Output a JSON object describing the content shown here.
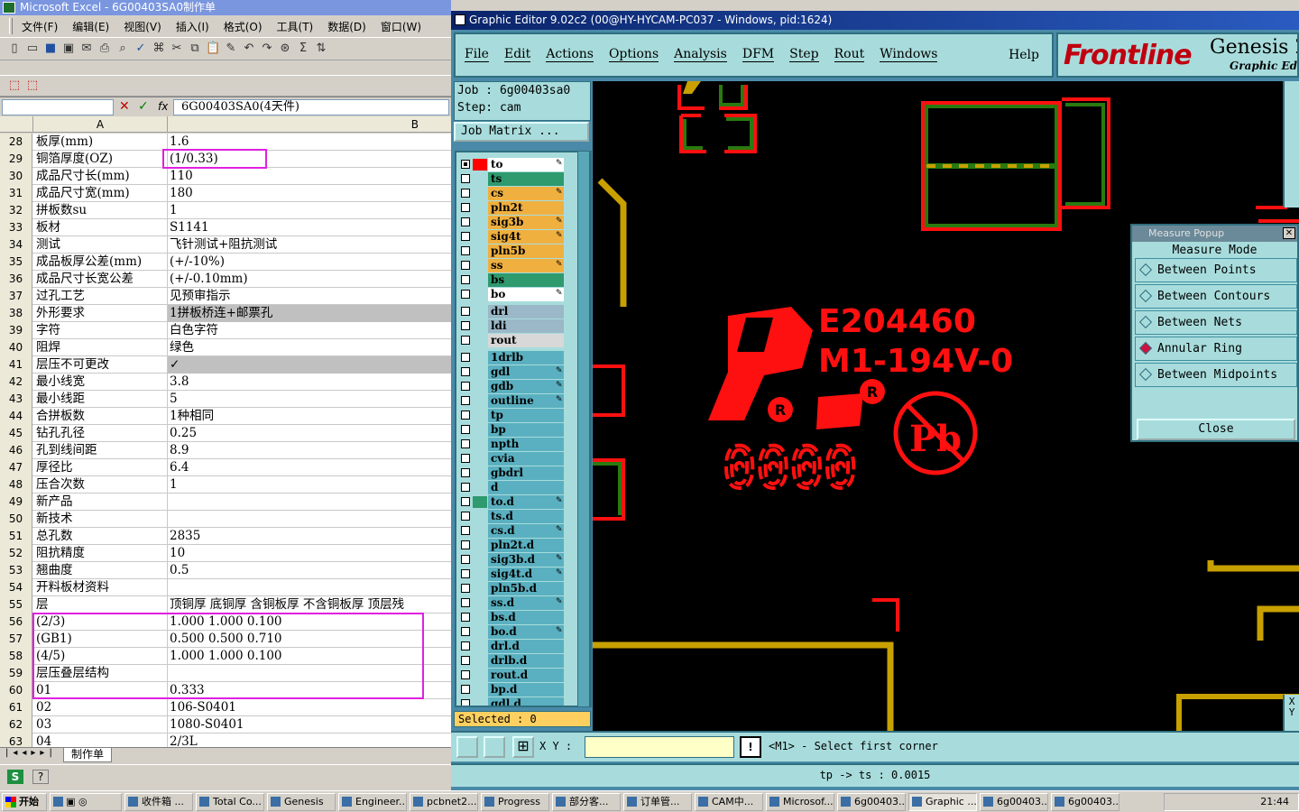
{
  "excel": {
    "title": "Microsoft Excel - 6G00403SA0制作单",
    "menu": [
      "文件(F)",
      "编辑(E)",
      "视图(V)",
      "插入(I)",
      "格式(O)",
      "工具(T)",
      "数据(D)",
      "窗口(W)"
    ],
    "formula_value": "6G00403SA0(4天件)",
    "columns": [
      "A",
      "B"
    ],
    "rows": [
      {
        "n": "28",
        "a": "板厚(mm)",
        "b": "1.6"
      },
      {
        "n": "29",
        "a": "铜箔厚度(OZ)",
        "b": "(1/0.33)"
      },
      {
        "n": "30",
        "a": "成品尺寸长(mm)",
        "b": "110"
      },
      {
        "n": "31",
        "a": "成品尺寸宽(mm)",
        "b": "180"
      },
      {
        "n": "32",
        "a": "拼板数su",
        "b": "1"
      },
      {
        "n": "33",
        "a": "板材",
        "b": "S1141"
      },
      {
        "n": "34",
        "a": "测试",
        "b": "飞针测试+阻抗测试"
      },
      {
        "n": "35",
        "a": "成品板厚公差(mm)",
        "b": "(+/-10%)"
      },
      {
        "n": "36",
        "a": "成品尺寸长宽公差",
        "b": "(+/-0.10mm)"
      },
      {
        "n": "37",
        "a": "过孔工艺",
        "b": "见预审指示"
      },
      {
        "n": "38",
        "a": "外形要求",
        "b": "1拼板桥连+邮票孔",
        "grey": true
      },
      {
        "n": "39",
        "a": "字符",
        "b": "白色字符"
      },
      {
        "n": "40",
        "a": "阻焊",
        "b": "绿色"
      },
      {
        "n": "41",
        "a": "层压不可更改",
        "b": "✓",
        "grey": true
      },
      {
        "n": "42",
        "a": "最小线宽",
        "b": "3.8"
      },
      {
        "n": "43",
        "a": "最小线距",
        "b": "5"
      },
      {
        "n": "44",
        "a": "合拼板数",
        "b": "1种相同"
      },
      {
        "n": "45",
        "a": "钻孔孔径",
        "b": "0.25"
      },
      {
        "n": "46",
        "a": "孔到线间距",
        "b": "8.9"
      },
      {
        "n": "47",
        "a": "厚径比",
        "b": "6.4"
      },
      {
        "n": "48",
        "a": "压合次数",
        "b": "1"
      },
      {
        "n": "49",
        "a": "新产品",
        "b": ""
      },
      {
        "n": "50",
        "a": "新技术",
        "b": ""
      },
      {
        "n": "51",
        "a": "总孔数",
        "b": "2835"
      },
      {
        "n": "52",
        "a": "阻抗精度",
        "b": "10"
      },
      {
        "n": "53",
        "a": "翘曲度",
        "b": "0.5"
      },
      {
        "n": "54",
        "a": "开料板材资料",
        "b": ""
      },
      {
        "n": "55",
        "a": "层",
        "b": "顶铜厚 底铜厚 含铜板厚 不含铜板厚 顶层残"
      },
      {
        "n": "56",
        "a": "(2/3)",
        "b": "1.000  1.000        0.100"
      },
      {
        "n": "57",
        "a": "(GB1)",
        "b": "0.500  0.500        0.710"
      },
      {
        "n": "58",
        "a": "(4/5)",
        "b": "1.000  1.000        0.100"
      },
      {
        "n": "59",
        "a": "层压叠层结构",
        "b": ""
      },
      {
        "n": "60",
        "a": "01",
        "b": "0.333"
      },
      {
        "n": "61",
        "a": "02",
        "b": "106-S0401"
      },
      {
        "n": "62",
        "a": "03",
        "b": "1080-S0401"
      },
      {
        "n": "63",
        "a": "04",
        "b": "2/3L"
      }
    ],
    "sheet_tab": "制作单"
  },
  "genesis": {
    "title": "Graphic Editor 9.02c2 (00@HY-HYCAM-PC037 - Windows, pid:1624)",
    "menu": [
      "File",
      "Edit",
      "Actions",
      "Options",
      "Analysis",
      "DFM",
      "Step",
      "Rout",
      "Windows"
    ],
    "help": "Help",
    "brand": "Frontline",
    "product": "Genesis 2",
    "product_sub": "Graphic Edit",
    "job_label": "Job : 6g00403sa0",
    "step_label": "Step: cam",
    "job_matrix": "Job Matrix ...",
    "layers": [
      {
        "name": "to",
        "color": "#ffffff",
        "ind": "#ff0000",
        "on": true,
        "w": true
      },
      {
        "name": "ts",
        "color": "#2e9a6e",
        "ind": "#a8dcdc",
        "on": false,
        "w": false
      },
      {
        "name": "cs",
        "color": "#f0b040",
        "ind": "#a8dcdc",
        "on": false,
        "w": true
      },
      {
        "name": "pln2t",
        "color": "#f0b040",
        "ind": "#a8dcdc",
        "on": false,
        "w": false
      },
      {
        "name": "sig3b",
        "color": "#f0b040",
        "ind": "#a8dcdc",
        "on": false,
        "w": true
      },
      {
        "name": "sig4t",
        "color": "#f0b040",
        "ind": "#a8dcdc",
        "on": false,
        "w": true
      },
      {
        "name": "pln5b",
        "color": "#f0b040",
        "ind": "#a8dcdc",
        "on": false,
        "w": false
      },
      {
        "name": "ss",
        "color": "#f0b040",
        "ind": "#a8dcdc",
        "on": false,
        "w": true
      },
      {
        "name": "bs",
        "color": "#2e9a6e",
        "ind": "#a8dcdc",
        "on": false,
        "w": false
      },
      {
        "name": "bo",
        "color": "#ffffff",
        "ind": "#a8dcdc",
        "on": false,
        "w": true
      },
      {
        "name": "drl",
        "color": "#9ab8c8",
        "ind": "#a8dcdc",
        "on": false,
        "w": false
      },
      {
        "name": "ldi",
        "color": "#9ab8c8",
        "ind": "#a8dcdc",
        "on": false,
        "w": false
      },
      {
        "name": "rout",
        "color": "#d8d8d8",
        "ind": "#a8dcdc",
        "on": false,
        "w": false
      },
      {
        "name": "1drlb",
        "color": "#5ab0c0",
        "ind": "#a8dcdc",
        "on": false,
        "w": false
      },
      {
        "name": "gdl",
        "color": "#5ab0c0",
        "ind": "#a8dcdc",
        "on": false,
        "w": true
      },
      {
        "name": "gdb",
        "color": "#5ab0c0",
        "ind": "#a8dcdc",
        "on": false,
        "w": true
      },
      {
        "name": "outline",
        "color": "#5ab0c0",
        "ind": "#a8dcdc",
        "on": false,
        "w": true
      },
      {
        "name": "tp",
        "color": "#5ab0c0",
        "ind": "#a8dcdc",
        "on": false,
        "w": false
      },
      {
        "name": "bp",
        "color": "#5ab0c0",
        "ind": "#a8dcdc",
        "on": false,
        "w": false
      },
      {
        "name": "npth",
        "color": "#5ab0c0",
        "ind": "#a8dcdc",
        "on": false,
        "w": false
      },
      {
        "name": "cvia",
        "color": "#5ab0c0",
        "ind": "#a8dcdc",
        "on": false,
        "w": false
      },
      {
        "name": "gbdrl",
        "color": "#5ab0c0",
        "ind": "#a8dcdc",
        "on": false,
        "w": false
      },
      {
        "name": "d",
        "color": "#5ab0c0",
        "ind": "#a8dcdc",
        "on": false,
        "w": false
      },
      {
        "name": "to.d",
        "color": "#5ab0c0",
        "ind": "#2e9a6e",
        "on": false,
        "w": true
      },
      {
        "name": "ts.d",
        "color": "#5ab0c0",
        "ind": "#a8dcdc",
        "on": false,
        "w": false
      },
      {
        "name": "cs.d",
        "color": "#5ab0c0",
        "ind": "#a8dcdc",
        "on": false,
        "w": true
      },
      {
        "name": "pln2t.d",
        "color": "#5ab0c0",
        "ind": "#a8dcdc",
        "on": false,
        "w": false
      },
      {
        "name": "sig3b.d",
        "color": "#5ab0c0",
        "ind": "#a8dcdc",
        "on": false,
        "w": true
      },
      {
        "name": "sig4t.d",
        "color": "#5ab0c0",
        "ind": "#a8dcdc",
        "on": false,
        "w": true
      },
      {
        "name": "pln5b.d",
        "color": "#5ab0c0",
        "ind": "#a8dcdc",
        "on": false,
        "w": false
      },
      {
        "name": "ss.d",
        "color": "#5ab0c0",
        "ind": "#a8dcdc",
        "on": false,
        "w": true
      },
      {
        "name": "bs.d",
        "color": "#5ab0c0",
        "ind": "#a8dcdc",
        "on": false,
        "w": false
      },
      {
        "name": "bo.d",
        "color": "#5ab0c0",
        "ind": "#a8dcdc",
        "on": false,
        "w": true
      },
      {
        "name": "drl.d",
        "color": "#5ab0c0",
        "ind": "#a8dcdc",
        "on": false,
        "w": false
      },
      {
        "name": "drlb.d",
        "color": "#5ab0c0",
        "ind": "#a8dcdc",
        "on": false,
        "w": false
      },
      {
        "name": "rout.d",
        "color": "#5ab0c0",
        "ind": "#a8dcdc",
        "on": false,
        "w": false
      },
      {
        "name": "bp.d",
        "color": "#5ab0c0",
        "ind": "#a8dcdc",
        "on": false,
        "w": false
      },
      {
        "name": "gdl.d",
        "color": "#5ab0c0",
        "ind": "#a8dcdc",
        "on": false,
        "w": false
      }
    ],
    "selected": "Selected : 0",
    "xy_label": "X Y :",
    "prompt": "<M1> - Select first corner",
    "status": "tp -> ts : 0.0015",
    "canvas_text": {
      "ul": "E204460",
      "rating": "M1-194V-0",
      "digits": "0000",
      "pb": "Pb",
      "xy": "X Y"
    },
    "measure": {
      "title": "Measure Popup",
      "mode_label": "Measure Mode",
      "options": [
        "Between Points",
        "Between Contours",
        "Between Nets",
        "Annular Ring",
        "Between Midpoints"
      ],
      "selected_option": "Annular Ring",
      "close": "Close"
    }
  },
  "taskbar": {
    "start": "开始",
    "items": [
      "收件箱 ...",
      "Total Co...",
      "Genesis",
      "Engineer...",
      "pcbnet2...",
      "Progress",
      "部分客...",
      "订单管...",
      "CAM中...",
      "Microsof...",
      "6g00403...",
      "Graphic ...",
      "6g00403...",
      "6g00403..."
    ],
    "active": "Graphic ...",
    "clock": "21:44"
  },
  "colors": {
    "pcb_red": "#ff1010",
    "pcb_green": "#2a7a10",
    "pcb_gold": "#c8a000",
    "panel": "#a8dcdc",
    "highlight": "#e020e0"
  }
}
